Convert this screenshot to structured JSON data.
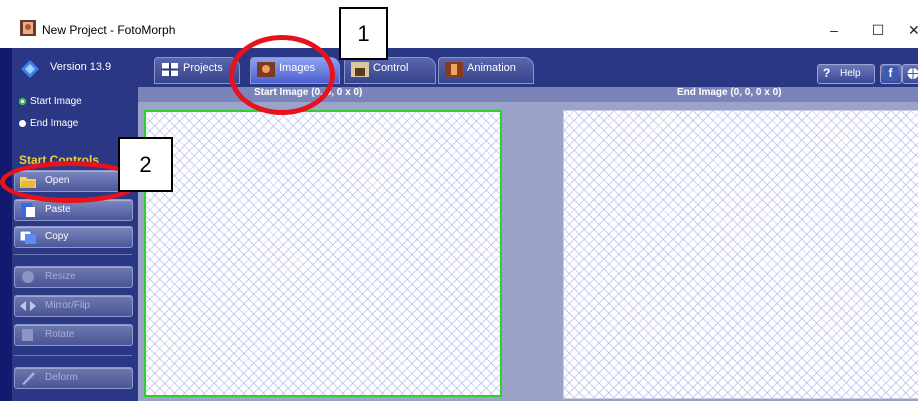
{
  "window": {
    "title": "New Project - FotoMorph",
    "controls": {
      "minimize": "–",
      "maximize": "☐",
      "close": "✕"
    }
  },
  "sidebar": {
    "version": "Version 13.9",
    "radios": [
      {
        "label": "Start Image",
        "selected": true
      },
      {
        "label": "End Image",
        "selected": false
      }
    ],
    "section_title": "Start Controls",
    "buttons": [
      {
        "label": "Open",
        "icon": "folder-open-icon",
        "enabled": true
      },
      {
        "label": "Paste",
        "icon": "paste-icon",
        "enabled": true
      },
      {
        "label": "Copy",
        "icon": "copy-icon",
        "enabled": true
      },
      {
        "label": "Resize",
        "icon": "resize-icon",
        "enabled": false
      },
      {
        "label": "Mirror/Flip",
        "icon": "mirror-flip-icon",
        "enabled": false
      },
      {
        "label": "Rotate",
        "icon": "rotate-icon",
        "enabled": false
      },
      {
        "label": "Deform",
        "icon": "deform-icon",
        "enabled": false
      }
    ]
  },
  "tabs": [
    {
      "label": "Projects",
      "icon": "grid-icon",
      "active": false
    },
    {
      "label": "Images",
      "icon": "portrait-icon",
      "active": true
    },
    {
      "label": "Control",
      "icon": "control-icon",
      "active": false
    },
    {
      "label": "Animation",
      "icon": "film-icon",
      "active": false
    }
  ],
  "toolbar_right": {
    "help_label": "Help",
    "help_icon": "question-icon",
    "facebook_icon": "facebook-icon",
    "globe_icon": "globe-icon"
  },
  "panels": {
    "start_title": "Start Image (0, 0, 0 x 0)",
    "end_title": "End Image (0, 0, 0 x 0)"
  },
  "annotations": {
    "callout_1": "1",
    "callout_2": "2",
    "highlight_color": "#e8121c"
  }
}
